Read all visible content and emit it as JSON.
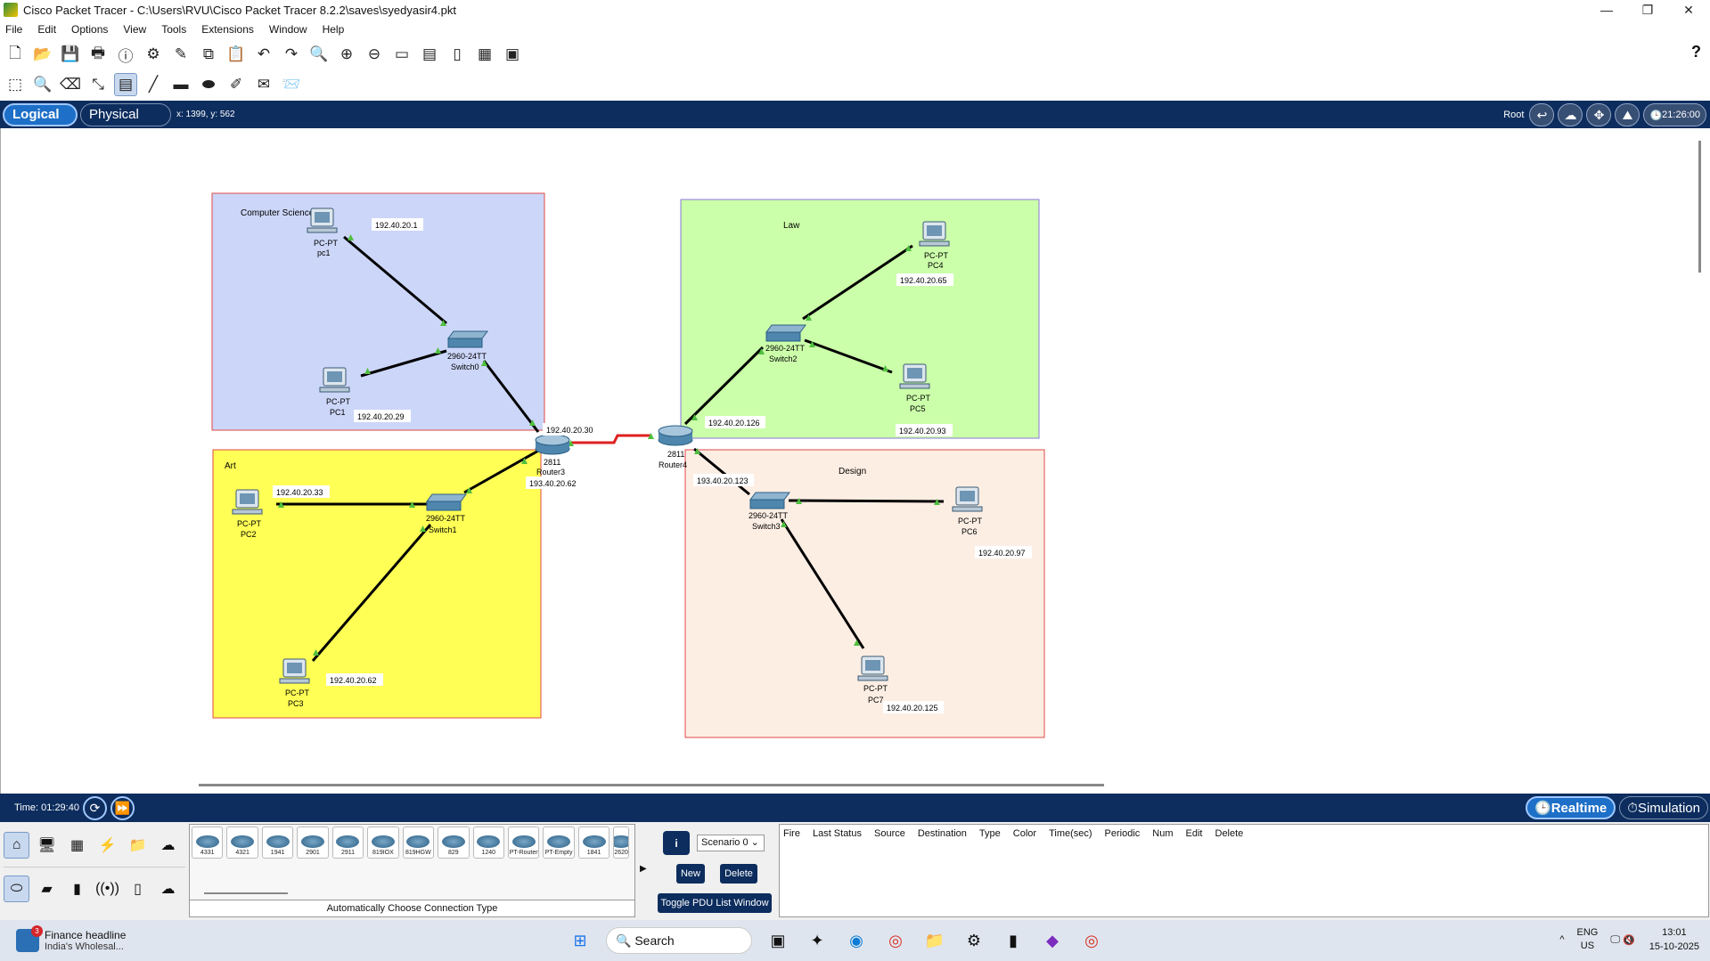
{
  "window": {
    "title": "Cisco Packet Tracer - C:\\Users\\RVU\\Cisco Packet Tracer 8.2.2\\saves\\syedyasir4.pkt",
    "minimize": "—",
    "maximize": "❐",
    "close": "✕"
  },
  "menu": [
    "File",
    "Edit",
    "Options",
    "View",
    "Tools",
    "Extensions",
    "Window",
    "Help"
  ],
  "toolbar_icons": [
    "new-icon",
    "open-icon",
    "save-icon",
    "print-icon",
    "info-icon",
    "network-wizard-icon",
    "activity-wizard-icon",
    "copy-icon",
    "paste-icon",
    "undo-icon",
    "redo-icon",
    "zoom-in-icon",
    "zoom-reset-icon",
    "zoom-out-icon",
    "drawing-palette-icon",
    "custom-devices-icon",
    "console-icon",
    "cluster-icon",
    "viewport-icon"
  ],
  "help_label": "?",
  "modes": {
    "logical": "Logical",
    "physical": "Physical",
    "coords": "x: 1399, y: 562",
    "root": "Root",
    "clock": "21:26:00"
  },
  "topology": {
    "areas": [
      {
        "label": "Computer Science",
        "color": "#ccd6f8",
        "border": "#e04848"
      },
      {
        "label": "Law",
        "color": "#ccffaa",
        "border": "#8a7ad8"
      },
      {
        "label": "Art",
        "color": "#ffff55",
        "border": "#e04848"
      },
      {
        "label": "Design",
        "color": "#fdeee4",
        "border": "#e04848"
      }
    ],
    "devices": [
      {
        "type": "PC-PT",
        "name": "pc1"
      },
      {
        "type": "PC-PT",
        "name": "PC1"
      },
      {
        "type": "2960-24TT",
        "name": "Switch0"
      },
      {
        "type": "PC-PT",
        "name": "PC2"
      },
      {
        "type": "2960-24TT",
        "name": "Switch1"
      },
      {
        "type": "PC-PT",
        "name": "PC3"
      },
      {
        "type": "2811",
        "name": "Router3"
      },
      {
        "type": "2811",
        "name": "Router4"
      },
      {
        "type": "PC-PT",
        "name": "PC4"
      },
      {
        "type": "2960-24TT",
        "name": "Switch2"
      },
      {
        "type": "PC-PT",
        "name": "PC5"
      },
      {
        "type": "2960-24TT",
        "name": "Switch3"
      },
      {
        "type": "PC-PT",
        "name": "PC6"
      },
      {
        "type": "PC-PT",
        "name": "PC7"
      }
    ],
    "ip_labels": [
      "192.40.20.1",
      "192.40.20.29",
      "192.40.20.33",
      "192.40.20.62",
      "192.40.20.30",
      "193.40.20.62",
      "192.40.20.65",
      "192.40.20.126",
      "192.40.20.93",
      "193.40.20.123",
      "192.40.20.97",
      "192.40.20.125"
    ]
  },
  "status": {
    "time": "Time: 01:29:40",
    "realtime": "Realtime",
    "simulation": "Simulation"
  },
  "device_models": [
    "4331",
    "4321",
    "1941",
    "2901",
    "2911",
    "819IOX",
    "819HGW",
    "829",
    "1240",
    "PT-Router",
    "PT-Empty",
    "1841",
    "2620"
  ],
  "connection_type": "Automatically Choose Connection Type",
  "scenario": {
    "select": "Scenario 0",
    "new": "New",
    "delete": "Delete",
    "toggle": "Toggle PDU List Window"
  },
  "pdu_columns": [
    "Fire",
    "Last Status",
    "Source",
    "Destination",
    "Type",
    "Color",
    "Time(sec)",
    "Periodic",
    "Num",
    "Edit",
    "Delete"
  ],
  "taskbar": {
    "news_title": "Finance headline",
    "news_sub": "India's Wholesal...",
    "news_badge": "3",
    "search": "Search",
    "lang1": "ENG",
    "lang2": "US",
    "time": "13:01",
    "date": "15-10-2025"
  }
}
